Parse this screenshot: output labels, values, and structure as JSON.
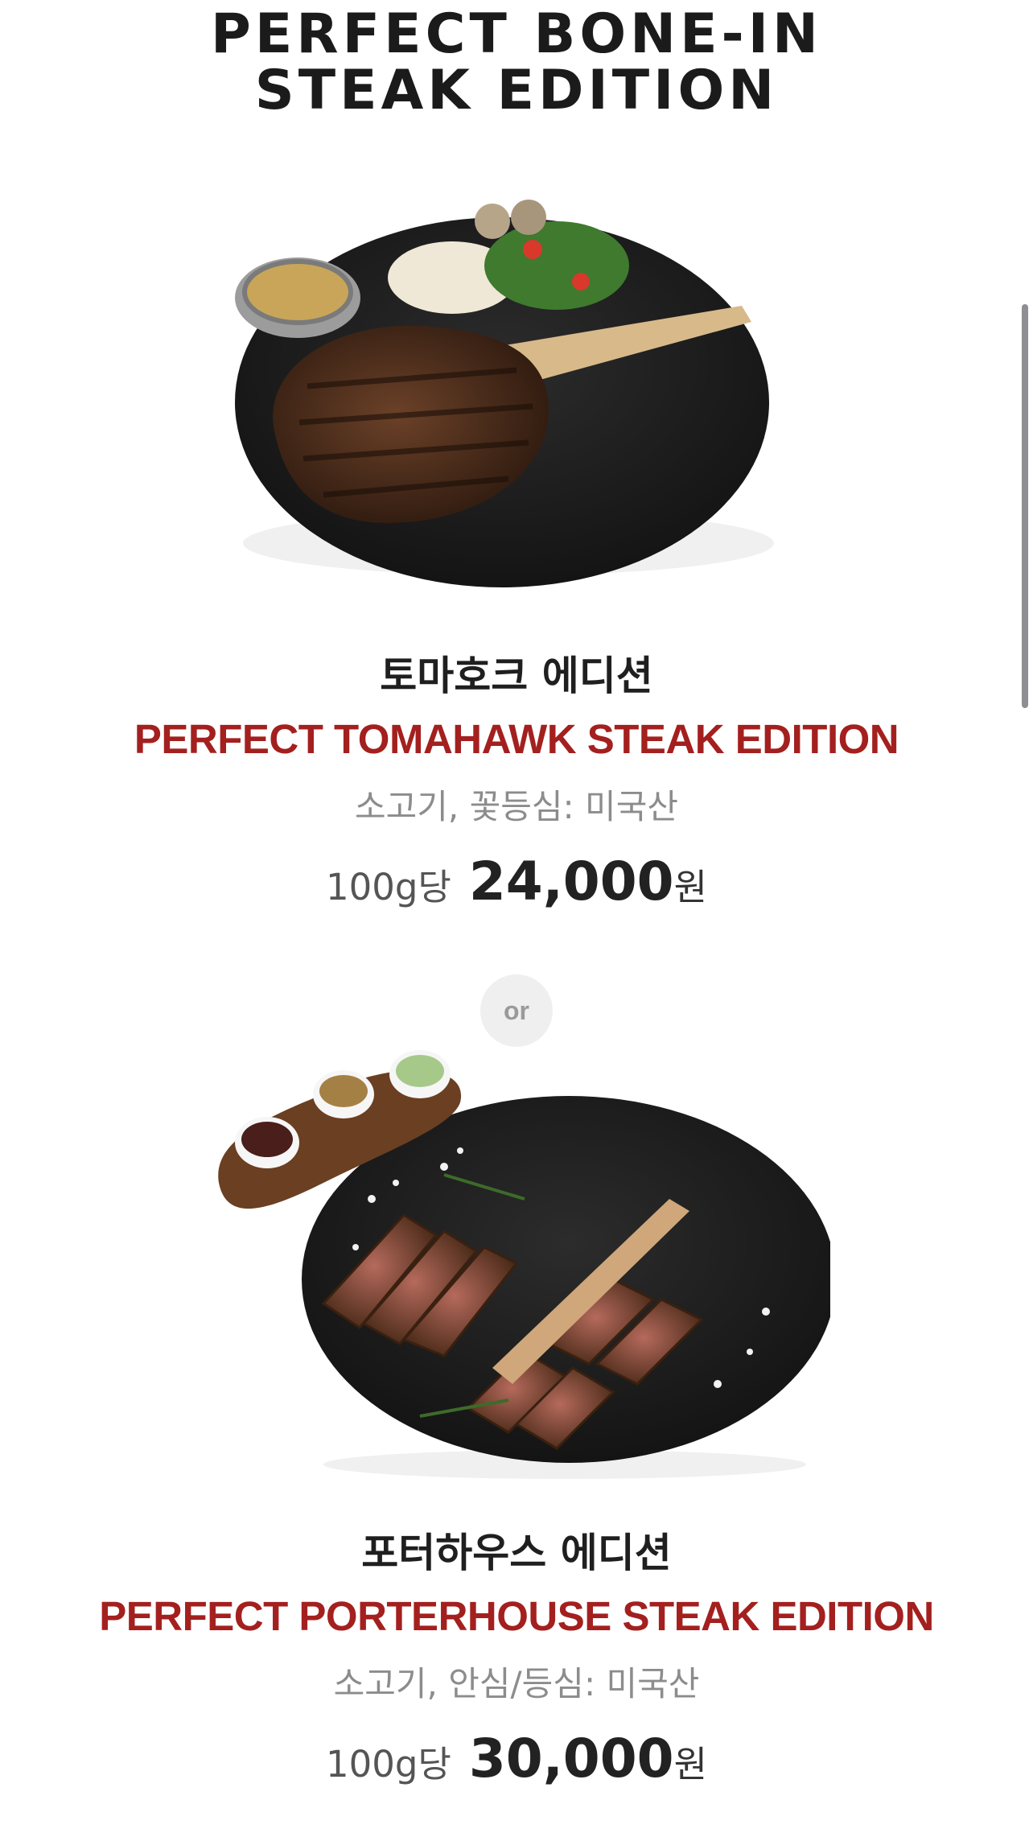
{
  "header": {
    "title_line1": "PERFECT BONE-IN",
    "title_line2": "STEAK EDITION"
  },
  "items": [
    {
      "kor_name": "토마호크 에디션",
      "eng_name": "PERFECT TOMAHAWK STEAK EDITION",
      "origin": "소고기, 꽃등심: 미국산",
      "price_unit": "100g당",
      "price": "24,000",
      "currency": "원",
      "image_icon": "tomahawk-steak-plate"
    },
    {
      "kor_name": "포터하우스 에디션",
      "eng_name": "PERFECT PORTERHOUSE STEAK EDITION",
      "origin": "소고기, 안심/등심: 미국산",
      "price_unit": "100g당",
      "price": "30,000",
      "currency": "원",
      "image_icon": "porterhouse-steak-plate"
    }
  ],
  "divider": {
    "label": "or"
  },
  "colors": {
    "accent_red": "#a3201f",
    "plate": "#1e1e1e",
    "meat": "#5a3520"
  }
}
